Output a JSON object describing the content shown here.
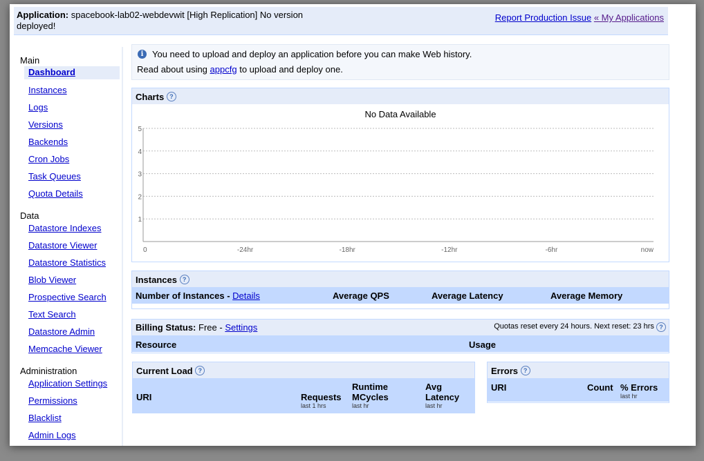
{
  "app": {
    "label": "Application:",
    "name_text": "spacebook-lab02-webdevwit [High Replication] No version deployed!",
    "report_link": "Report Production Issue",
    "my_apps_link": "« My Applications"
  },
  "sidebar": {
    "sections": [
      {
        "heading": "Main",
        "items": [
          "Dashboard",
          "Instances",
          "Logs",
          "Versions",
          "Backends",
          "Cron Jobs",
          "Task Queues",
          "Quota Details"
        ]
      },
      {
        "heading": "Data",
        "items": [
          "Datastore Indexes",
          "Datastore Viewer",
          "Datastore Statistics",
          "Blob Viewer",
          "Prospective Search",
          "Text Search",
          "Datastore Admin",
          "Memcache Viewer"
        ]
      },
      {
        "heading": "Administration",
        "items": [
          "Application Settings",
          "Permissions",
          "Blacklist",
          "Admin Logs"
        ]
      }
    ],
    "selected": "Dashboard"
  },
  "notice": {
    "line1": "You need to upload and deploy an application before you can make Web history.",
    "line2_pre": "Read about using",
    "line2_link": "appcfg",
    "line2_post": "to upload and deploy one."
  },
  "charts": {
    "title": "Charts",
    "no_data": "No Data Available"
  },
  "chart_data": {
    "type": "line",
    "title": "No Data Available",
    "x_tick_labels": [
      "0",
      "-24hr",
      "-18hr",
      "-12hr",
      "-6hr",
      "now"
    ],
    "y_tick_labels": [
      "1",
      "2",
      "3",
      "4",
      "5"
    ],
    "ylim": [
      0,
      5
    ],
    "series": [],
    "grid": true
  },
  "instances": {
    "title": "Instances",
    "count_label": "Number of Instances -",
    "details_link": "Details",
    "cols": [
      "Average QPS",
      "Average Latency",
      "Average Memory"
    ]
  },
  "billing": {
    "label": "Billing Status:",
    "status": "Free -",
    "settings_link": "Settings",
    "quota_note": "Quotas reset every 24 hours. Next reset: 23 hrs",
    "cols": [
      "Resource",
      "Usage"
    ]
  },
  "current_load": {
    "title": "Current Load",
    "cols": [
      {
        "label": "URI",
        "sub": ""
      },
      {
        "label": "Requests",
        "sub": "last 1 hrs"
      },
      {
        "label": "Runtime MCycles",
        "sub": "last hr"
      },
      {
        "label": "Avg Latency",
        "sub": "last hr"
      }
    ]
  },
  "errors": {
    "title": "Errors",
    "cols": [
      {
        "label": "URI",
        "sub": ""
      },
      {
        "label": "Count",
        "sub": ""
      },
      {
        "label": "% Errors",
        "sub": "last hr"
      }
    ]
  },
  "colors": {
    "header_bg": "#e5ecf9",
    "column_header_bg": "#c3d9ff",
    "link": "#0000cc"
  }
}
